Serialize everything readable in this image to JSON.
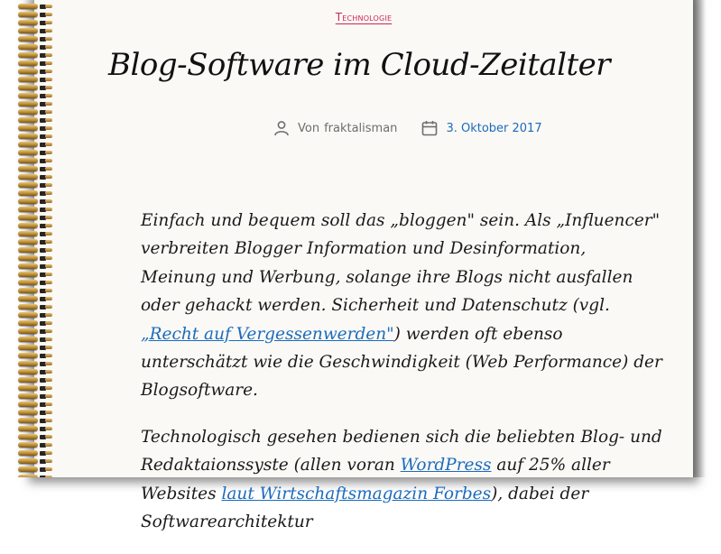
{
  "post": {
    "category": "Technologie",
    "title": "Blog-Software im Cloud-Zeitalter",
    "author_prefix": "Von",
    "author": "fraktalisman",
    "date": "3. Oktober 2017"
  },
  "paragraph1": {
    "part1": "Einfach und bequem soll das „bloggen\" sein. Als „Influencer\" verbreiten Blogger Information und Desinformation, Meinung und Werbung, solange ihre Blogs nicht ausfallen oder gehackt werden. Sicherheit und Datenschutz (vgl. ",
    "link": "„Recht auf Vergessenwerden\"",
    "part2": ") werden oft ebenso unterschätzt wie die Geschwindigkeit (Web Performance) der Blogsoftware."
  },
  "paragraph2": {
    "part1": "Technologisch gesehen bedienen sich die beliebten Blog- und Redaktaionssyste (allen voran ",
    "link1": "WordPress",
    "part2": " auf 25% aller Websites ",
    "link2": "laut Wirtschaftsmagazin Forbes",
    "part3": "), dabei der Softwarearchitektur"
  },
  "colors": {
    "accent": "#cd2653",
    "link": "#1b6bbd",
    "text": "#1a1a1a",
    "page": "#fbf9f6",
    "spiral": "#b8862f"
  },
  "icons": {
    "author": "person-icon",
    "date": "calendar-icon"
  }
}
